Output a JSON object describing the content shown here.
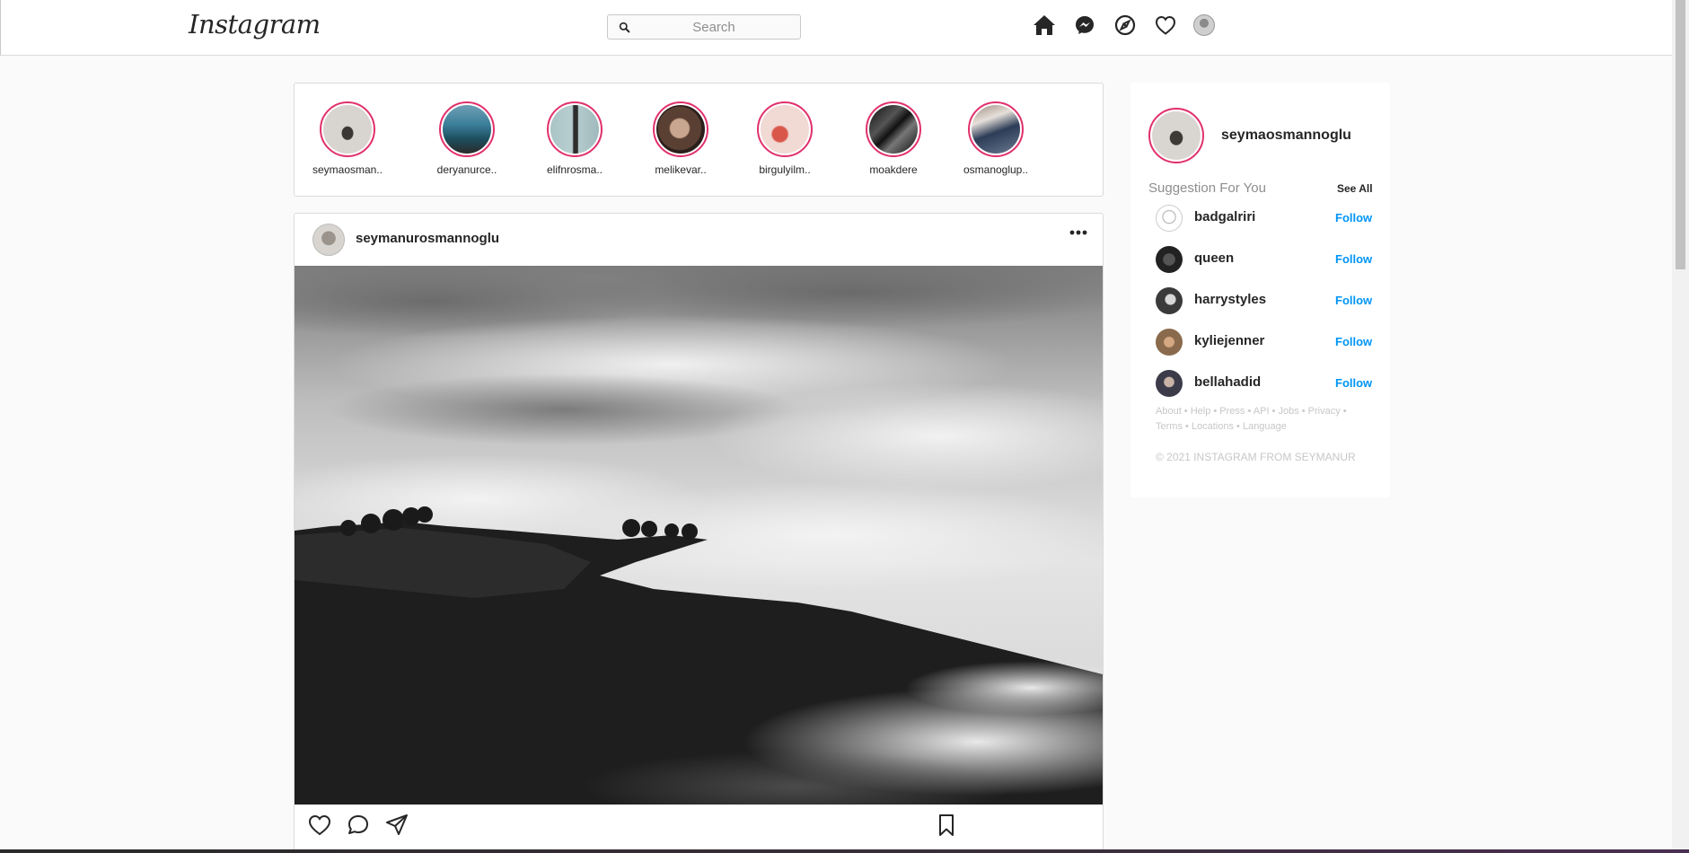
{
  "nav": {
    "logo": "Instagram",
    "search_placeholder": "Search"
  },
  "stories": [
    {
      "name": "seymaosman.."
    },
    {
      "name": "deryanurce.."
    },
    {
      "name": "elifnrosma.."
    },
    {
      "name": "melikevar.."
    },
    {
      "name": "birgulyilm.."
    },
    {
      "name": "moakdere"
    },
    {
      "name": "osmanoglup.."
    }
  ],
  "post": {
    "username": "seymanurosmannoglu"
  },
  "sidebar": {
    "username": "seymaosmannoglu",
    "suggestion_title": "Suggestion For You",
    "see_all": "See All",
    "suggestions": [
      {
        "name": "badgalriri",
        "action": "Follow"
      },
      {
        "name": "queen",
        "action": "Follow"
      },
      {
        "name": "harrystyles",
        "action": "Follow"
      },
      {
        "name": "kyliejenner",
        "action": "Follow"
      },
      {
        "name": "bellahadid",
        "action": "Follow"
      }
    ],
    "footer_links_line1": "About • Help • Press • API • Jobs • Privacy •",
    "footer_links_line2": "Terms • Locations • Language",
    "copyright": "© 2021 INSTAGRAM FROM SEYMANUR"
  },
  "colors": {
    "accent": "#0095f6",
    "story_ring": "#e1306c",
    "border": "#dbdbdb"
  },
  "icons": {
    "nav": [
      "home-icon",
      "messenger-icon",
      "explore-icon",
      "heart-icon",
      "profile-avatar"
    ],
    "post_actions": [
      "like-icon",
      "comment-icon",
      "share-icon",
      "bookmark-icon"
    ]
  }
}
